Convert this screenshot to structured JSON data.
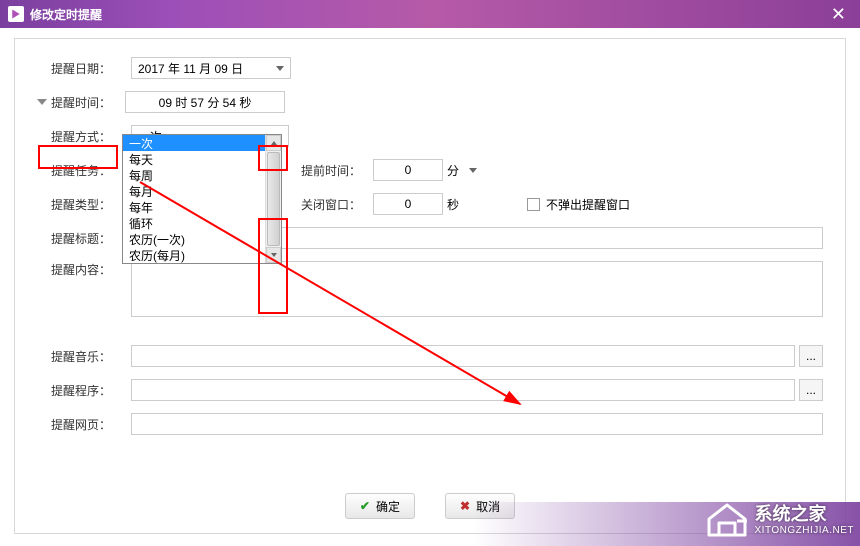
{
  "window": {
    "title": "修改定时提醒"
  },
  "labels": {
    "date": "提醒日期：",
    "time": "提醒时间：",
    "mode": "提醒方式：",
    "task": "提醒任务：",
    "type": "提醒类型：",
    "title": "提醒标题：",
    "content": "提醒内容：",
    "music": "提醒音乐：",
    "program": "提醒程序：",
    "web": "提醒网页：",
    "advance": "提前时间：",
    "close": "关闭窗口：",
    "nopopup": "不弹出提醒窗口"
  },
  "values": {
    "date": "2017 年 11 月 09 日",
    "time": "09 时 57 分 54 秒",
    "mode": "一次",
    "advance_value": "0",
    "advance_unit": "分",
    "close_value": "0",
    "close_unit": "秒",
    "ellipsis": "..."
  },
  "dropdown": {
    "options": [
      "一次",
      "每天",
      "每周",
      "每月",
      "每年",
      "循环",
      "农历(一次)",
      "农历(每月)"
    ],
    "selected_index": 0
  },
  "buttons": {
    "ok": "确定",
    "cancel": "取消"
  },
  "watermark": {
    "cn": "系统之家",
    "en": "XITONGZHIJIA.NET"
  }
}
